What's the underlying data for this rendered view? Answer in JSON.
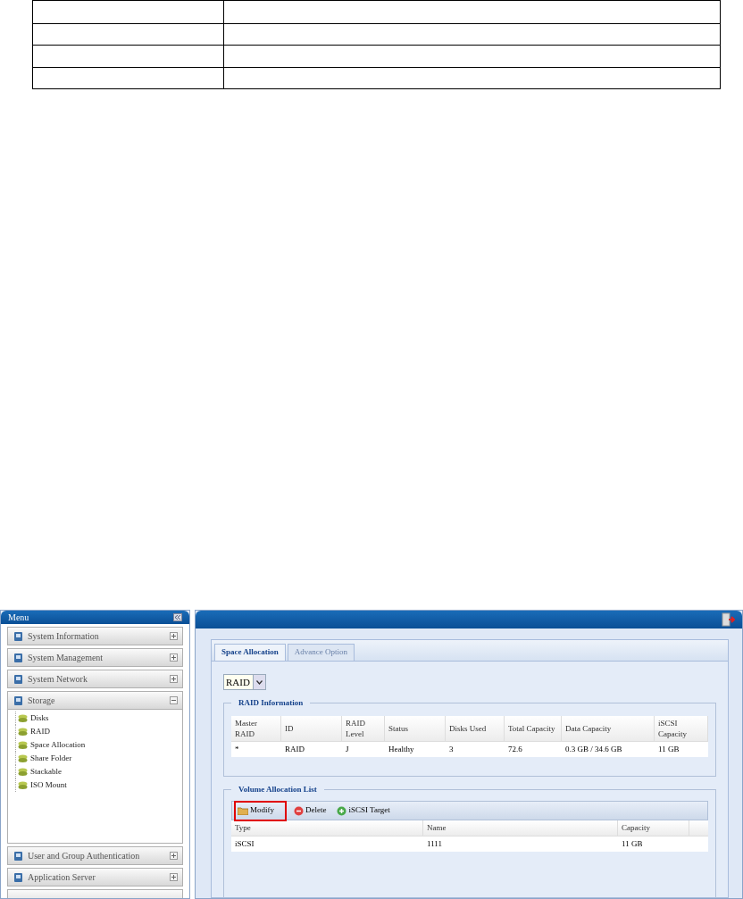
{
  "menu": {
    "title": "Menu",
    "items": [
      {
        "label": "System Information",
        "expanded": false
      },
      {
        "label": "System Management",
        "expanded": false
      },
      {
        "label": "System Network",
        "expanded": false
      },
      {
        "label": "Storage",
        "expanded": true,
        "children": [
          {
            "label": "Disks"
          },
          {
            "label": "RAID"
          },
          {
            "label": "Space Allocation"
          },
          {
            "label": "Share Folder"
          },
          {
            "label": "Stackable"
          },
          {
            "label": "ISO Mount"
          }
        ]
      },
      {
        "label": "User and Group Authentication",
        "expanded": false
      },
      {
        "label": "Application Server",
        "expanded": false
      }
    ]
  },
  "tabs": [
    {
      "label": "Space Allocation",
      "selected": true
    },
    {
      "label": "Advance Option",
      "selected": false
    }
  ],
  "raid_select": {
    "value": "RAID"
  },
  "raid_information": {
    "title": "RAID Information",
    "columns": [
      "Master RAID",
      "ID",
      "RAID Level",
      "Status",
      "Disks Used",
      "Total Capacity",
      "Data Capacity",
      "iSCSI Capacity"
    ],
    "rows": [
      [
        "*",
        "RAID",
        "J",
        "Healthy",
        "3",
        "72.6",
        "0.3 GB / 34.6 GB",
        "11 GB"
      ]
    ]
  },
  "volume_allocation_list": {
    "title": "Volume Allocation List",
    "toolbar": [
      {
        "label": "Modify",
        "kind": "modify",
        "highlighted": true
      },
      {
        "label": "Delete",
        "kind": "delete",
        "highlighted": false
      },
      {
        "label": "iSCSI Target",
        "kind": "add",
        "highlighted": false
      }
    ],
    "columns": [
      "Type",
      "Name",
      "Capacity"
    ],
    "rows": [
      [
        "iSCSI",
        "1111",
        "11 GB"
      ]
    ]
  }
}
